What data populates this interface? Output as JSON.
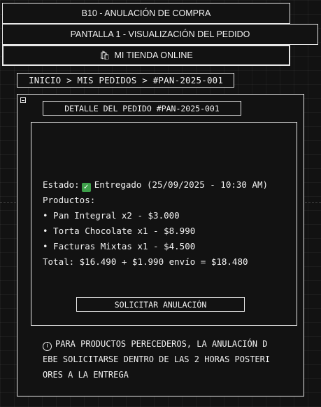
{
  "header": {
    "section_title": "B10 - ANULACIÓN DE COMPRA",
    "screen_title": "PANTALLA 1 - VISUALIZACIÓN DEL PEDIDO",
    "store_name": "MI TIENDA ONLINE",
    "store_icon": "shopping-bags-icon"
  },
  "breadcrumb": {
    "text": "INICIO > MIS PEDIDOS > #PAN-2025-001"
  },
  "panel": {
    "title": "DETALLE DEL PEDIDO #PAN-2025-001",
    "toggle_icon": "collapse-minus-icon"
  },
  "order": {
    "status_label": "Estado:",
    "status_value": "Entregado (25/09/2025 - 10:30 AM)",
    "status_icon": "check-mark-icon",
    "products_label": "Productos:",
    "items": [
      "• Pan Integral x2 - $3.000",
      "• Torta Chocolate x1 - $8.990",
      "• Facturas Mixtas x1 - $4.500"
    ],
    "total": "Total: $16.490 + $1.990 envío = $18.480"
  },
  "actions": {
    "cancel_label": "SOLICITAR ANULACIÓN"
  },
  "notice": {
    "icon": "info-icon",
    "lines": [
      "PARA PRODUCTOS PERECEDEROS, LA ANULACIÓN D",
      "EBE SOLICITARSE DENTRO DE LAS 2 HORAS POSTERI",
      "ORES A LA ENTREGA"
    ]
  },
  "colors": {
    "background": "#121212",
    "border": "#e8e8e8",
    "text": "#f2f2f2",
    "check_green": "#3ea04a"
  }
}
